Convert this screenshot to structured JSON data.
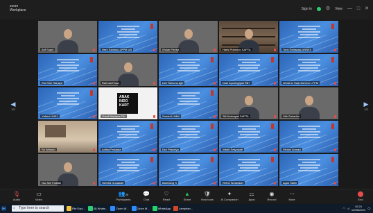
{
  "window": {
    "brand_line1": "zoom",
    "brand_line2": "Workplace",
    "sign_in": "Sign in",
    "view_label": "View",
    "controls": [
      "—",
      "□",
      "✕"
    ]
  },
  "navigation": {
    "left_page": "1/2",
    "right_page": "1/2"
  },
  "colors": {
    "slide_blue": "#3d7fd6",
    "muted_red": "#e34c4c",
    "video_green": "#29c25a"
  },
  "tiles": [
    {
      "type": "cam",
      "name": "Arif Sugiri"
    },
    {
      "type": "slide",
      "name": "Heru Santoso LPPM UB"
    },
    {
      "type": "cam",
      "name": "Wulan Pertiwi"
    },
    {
      "type": "books",
      "name": "Haris Pramono SAPTA"
    },
    {
      "type": "slide",
      "name": "Tony Setiawan-UNNES"
    },
    {
      "type": "slide",
      "name": "Rini Sari Rahayu"
    },
    {
      "type": "cam",
      "name": "Rahmat Fauzi"
    },
    {
      "type": "slide",
      "name": "Dwi Harsono Ajie"
    },
    {
      "type": "slide",
      "name": "Dian Ayuningtyas SBY"
    },
    {
      "type": "slide",
      "name": "Winarno Hadi Suhono LPPM"
    },
    {
      "type": "slide",
      "name": "Yuliani-UNEJ"
    },
    {
      "type": "logo",
      "name": "Yusuf Maulana FIK",
      "emblem": "ANAK INDO KART"
    },
    {
      "type": "slide",
      "name": "Sunardi-UMM"
    },
    {
      "type": "cam",
      "name": "Siti Nurhayati SAPTA"
    },
    {
      "type": "cam",
      "name": "Lilik Suhartini"
    },
    {
      "type": "room",
      "name": "Sri Widodo"
    },
    {
      "type": "slide",
      "name": "Aditya Pratama"
    },
    {
      "type": "slide",
      "name": "Eko Prasetyo"
    },
    {
      "type": "slide",
      "name": "Wiwik Setyowati"
    },
    {
      "type": "slide",
      "name": "Fitriani Ahmad"
    },
    {
      "type": "cam",
      "name": "Nur Aini Fadilah"
    },
    {
      "type": "slide",
      "name": "Hendra Gunawan"
    },
    {
      "type": "slide",
      "name": "Bambang S"
    },
    {
      "type": "slide",
      "name": "Retno Wulandari"
    },
    {
      "type": "slide",
      "name": "Agus Salim"
    }
  ],
  "toolbar": {
    "audio": "Audio",
    "video": "Video",
    "participants": "Participants",
    "participants_count": "25",
    "chat": "Chat",
    "react": "React",
    "share": "Share",
    "host_tools": "Host tools",
    "ai_companion": "AI Companion",
    "apps": "Apps",
    "record": "Record",
    "more": "More",
    "end": "End"
  },
  "taskbar": {
    "search_placeholder": "Type here to search",
    "apps": [
      {
        "label": "File Expl...",
        "color": "#f0c040"
      },
      {
        "label": "(5) Whats...",
        "color": "#2ecc71"
      },
      {
        "label": "Zoom W...",
        "color": "#2d8cff"
      },
      {
        "label": "Zoom M...",
        "color": "#2d8cff"
      },
      {
        "label": "WhatsApp",
        "color": "#25d366"
      },
      {
        "label": "Lampiran...",
        "color": "#d24726"
      }
    ],
    "time": "10:24",
    "date": "10/08/2024"
  }
}
